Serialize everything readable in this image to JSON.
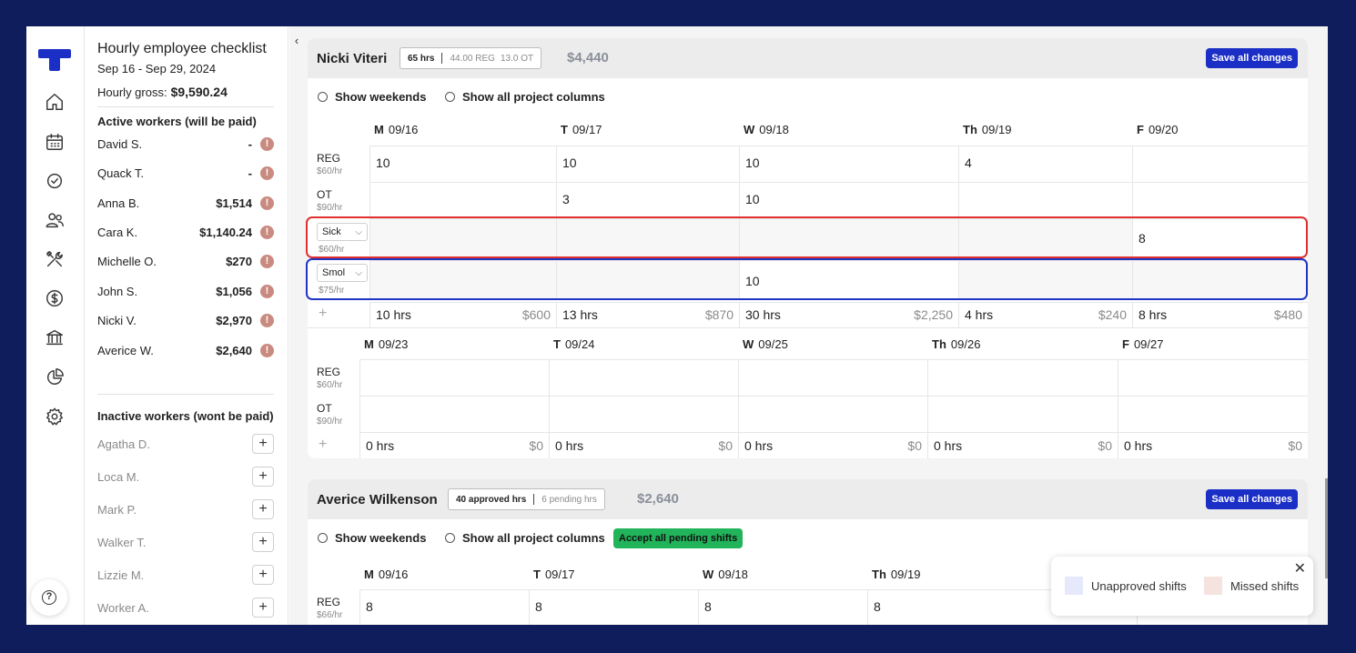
{
  "panel": {
    "title": "Hourly employee checklist",
    "range": "Sep 16 - Sep 29, 2024",
    "gross_label": "Hourly gross:",
    "gross_value": "$9,590.24",
    "active_header": "Active workers (will be paid)",
    "active": [
      {
        "name": "David S.",
        "amount": "-"
      },
      {
        "name": "Quack T.",
        "amount": "-"
      },
      {
        "name": "Anna B.",
        "amount": "$1,514"
      },
      {
        "name": "Cara K.",
        "amount": "$1,140.24"
      },
      {
        "name": "Michelle O.",
        "amount": "$270"
      },
      {
        "name": "John S.",
        "amount": "$1,056"
      },
      {
        "name": "Nicki V.",
        "amount": "$2,970"
      },
      {
        "name": "Averice W.",
        "amount": "$2,640"
      }
    ],
    "warn_glyph": "!",
    "inactive_header": "Inactive workers (wont be paid)",
    "inactive": [
      "Agatha D.",
      "Loca M.",
      "Mark P.",
      "Walker T.",
      "Lizzie M.",
      "Worker A."
    ],
    "add_glyph": "+"
  },
  "collapse_glyph": "‹",
  "help_glyph": "?",
  "card1": {
    "name": "Nicki Viteri",
    "hours": "65 hrs",
    "reg": "44.00 REG",
    "ot": "13.0 OT",
    "total": "$4,440",
    "save": "Save all changes",
    "opt_weekends": "Show weekends",
    "opt_projects": "Show all project columns",
    "week1": {
      "days": [
        {
          "d": "M",
          "date": "09/16"
        },
        {
          "d": "T",
          "date": "09/17"
        },
        {
          "d": "W",
          "date": "09/18"
        },
        {
          "d": "Th",
          "date": "09/19"
        },
        {
          "d": "F",
          "date": "09/20"
        }
      ],
      "rows": [
        {
          "label": "REG",
          "rate": "$60/hr",
          "values": [
            "10",
            "10",
            "10",
            "4",
            ""
          ]
        },
        {
          "label": "OT",
          "rate": "$90/hr",
          "values": [
            "",
            "3",
            "10",
            "",
            ""
          ]
        },
        {
          "label": "Sick",
          "rate": "$60/hr",
          "values": [
            "",
            "",
            "",
            "",
            "8"
          ]
        },
        {
          "label": "Smol",
          "rate": "$75/hr",
          "values": [
            "",
            "",
            "10",
            "",
            ""
          ]
        }
      ],
      "totals": [
        {
          "hrs": "10 hrs",
          "usd": "$600"
        },
        {
          "hrs": "13 hrs",
          "usd": "$870"
        },
        {
          "hrs": "30 hrs",
          "usd": "$2,250"
        },
        {
          "hrs": "4 hrs",
          "usd": "$240"
        },
        {
          "hrs": "8 hrs",
          "usd": "$480"
        }
      ]
    },
    "week2": {
      "days": [
        {
          "d": "M",
          "date": "09/23"
        },
        {
          "d": "T",
          "date": "09/24"
        },
        {
          "d": "W",
          "date": "09/25"
        },
        {
          "d": "Th",
          "date": "09/26"
        },
        {
          "d": "F",
          "date": "09/27"
        }
      ],
      "rows": [
        {
          "label": "REG",
          "rate": "$60/hr"
        },
        {
          "label": "OT",
          "rate": "$90/hr"
        }
      ],
      "totals": [
        {
          "hrs": "0 hrs",
          "usd": "$0"
        },
        {
          "hrs": "0 hrs",
          "usd": "$0"
        },
        {
          "hrs": "0 hrs",
          "usd": "$0"
        },
        {
          "hrs": "0 hrs",
          "usd": "$0"
        },
        {
          "hrs": "0 hrs",
          "usd": "$0"
        }
      ]
    }
  },
  "card2": {
    "name": "Averice Wilkenson",
    "approved": "40 approved hrs",
    "pending": "6 pending hrs",
    "total": "$2,640",
    "save": "Save all changes",
    "opt_weekends": "Show weekends",
    "opt_projects": "Show all project columns",
    "accept": "Accept all pending shifts",
    "days": [
      {
        "d": "M",
        "date": "09/16"
      },
      {
        "d": "T",
        "date": "09/17"
      },
      {
        "d": "W",
        "date": "09/18"
      },
      {
        "d": "Th",
        "date": "09/19"
      }
    ],
    "reg": {
      "label": "REG",
      "rate": "$66/hr",
      "values": [
        "8",
        "8",
        "8",
        "8"
      ]
    }
  },
  "legend": {
    "unapproved": "Unapproved shifts",
    "missed": "Missed shifts",
    "close": "✕"
  },
  "colors": {
    "sidebar_bg": "#0f1d5c",
    "primary": "#1b2fc7",
    "accent_green": "#21b45a",
    "sick_outline": "#e03030",
    "smol_outline": "#1f35c4",
    "warn": "#c98a7f",
    "unapproved_swatch": "#e6e9fb",
    "missed_swatch": "#f5e3e0"
  }
}
